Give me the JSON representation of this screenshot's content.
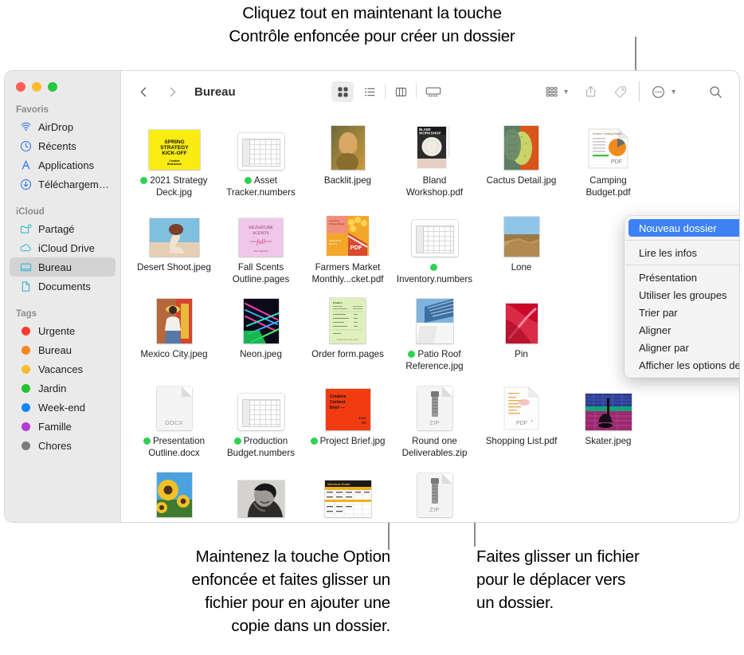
{
  "callouts": {
    "top": "Cliquez tout en maintenant la touche\nContrôle enfoncée pour créer un dossier",
    "option_drag": "Maintenez la touche Option\nenfoncée et faites glisser un\nfichier pour en ajouter une\ncopie dans un dossier.",
    "move_drag": "Faites glisser un fichier\npour le déplacer vers\nun dossier."
  },
  "window": {
    "title": "Bureau"
  },
  "sidebar": {
    "sections": [
      {
        "title": "Favoris",
        "items": [
          {
            "label": "AirDrop",
            "icon": "airdrop-icon",
            "selected": false
          },
          {
            "label": "Récents",
            "icon": "clock-icon",
            "selected": false
          },
          {
            "label": "Applications",
            "icon": "applications-icon",
            "selected": false
          },
          {
            "label": "Téléchargements",
            "icon": "downloads-icon",
            "selected": false
          }
        ]
      },
      {
        "title": "iCloud",
        "items": [
          {
            "label": "Partagé",
            "icon": "shared-folder-icon",
            "selected": false
          },
          {
            "label": "iCloud Drive",
            "icon": "cloud-icon",
            "selected": false
          },
          {
            "label": "Bureau",
            "icon": "desktop-icon",
            "selected": true
          },
          {
            "label": "Documents",
            "icon": "document-icon",
            "selected": false
          }
        ]
      },
      {
        "title": "Tags",
        "items": [
          {
            "label": "Urgente",
            "icon": "tag-dot-icon",
            "color": "#fc3b33"
          },
          {
            "label": "Bureau",
            "icon": "tag-dot-icon",
            "color": "#f8871f"
          },
          {
            "label": "Vacances",
            "icon": "tag-dot-icon",
            "color": "#f9bc2c"
          },
          {
            "label": "Jardin",
            "icon": "tag-dot-icon",
            "color": "#22c32f"
          },
          {
            "label": "Week-end",
            "icon": "tag-dot-icon",
            "color": "#1386fb"
          },
          {
            "label": "Famille",
            "icon": "tag-dot-icon",
            "color": "#b63ad8"
          },
          {
            "label": "Chores",
            "icon": "tag-dot-icon",
            "color": "#7c7c80"
          }
        ]
      }
    ]
  },
  "toolbar": {
    "back": "back-icon",
    "forward": "forward-icon",
    "views": [
      {
        "name": "icon-view",
        "active": true
      },
      {
        "name": "list-view",
        "active": false
      },
      {
        "name": "column-view",
        "active": false
      },
      {
        "name": "gallery-view",
        "active": false
      }
    ],
    "group_by": "group-by-icon",
    "share": "share-icon",
    "tag": "tag-icon",
    "more": "more-actions-icon",
    "search": "search-icon"
  },
  "files": [
    [
      {
        "name": "2021 Strategy Deck.jpg",
        "tag": true,
        "thumb": "spring-strategy"
      },
      {
        "name": "Asset Tracker.numbers",
        "tag": true,
        "thumb": "numbers"
      },
      {
        "name": "Backlit.jpeg",
        "tag": false,
        "thumb": "backlit"
      },
      {
        "name": "Bland Workshop.pdf",
        "tag": false,
        "thumb": "bland-workshop"
      },
      {
        "name": "Cactus Detail.jpg",
        "tag": false,
        "thumb": "cactus"
      },
      {
        "name": "Camping Budget.pdf",
        "tag": false,
        "thumb": "pdf-chart"
      }
    ],
    [
      {
        "name": "Desert Shoot.jpeg",
        "tag": false,
        "thumb": "desert"
      },
      {
        "name": "Fall Scents Outline.pages",
        "tag": false,
        "thumb": "signature-scents"
      },
      {
        "name": "Farmers Market Monthly...cket.pdf",
        "tag": false,
        "thumb": "farmers-market"
      },
      {
        "name": "Inventory.numbers",
        "tag": true,
        "thumb": "numbers"
      },
      {
        "name": "Lone",
        "tag": false,
        "thumb": "lone"
      },
      {
        "name": "",
        "tag": false,
        "thumb": "hidden"
      }
    ],
    [
      {
        "name": "Mexico City.jpeg",
        "tag": false,
        "thumb": "mexico"
      },
      {
        "name": "Neon.jpeg",
        "tag": false,
        "thumb": "neon"
      },
      {
        "name": "Order form.pages",
        "tag": false,
        "thumb": "order-form"
      },
      {
        "name": "Patio Roof Reference.jpg",
        "tag": true,
        "thumb": "patio"
      },
      {
        "name": "Pin",
        "tag": false,
        "thumb": "pink-flower"
      },
      {
        "name": "",
        "tag": false,
        "thumb": "hidden"
      }
    ],
    [
      {
        "name": "Presentation Outline.docx",
        "tag": true,
        "thumb": "docx"
      },
      {
        "name": "Production Budget.numbers",
        "tag": true,
        "thumb": "numbers"
      },
      {
        "name": "Project Brief.jpg",
        "tag": true,
        "thumb": "creative-brief"
      },
      {
        "name": "Round one Deliverables.zip",
        "tag": false,
        "thumb": "zip"
      },
      {
        "name": "Shopping List.pdf",
        "tag": false,
        "thumb": "pdf-list"
      },
      {
        "name": "Skater.jpeg",
        "tag": false,
        "thumb": "skater"
      }
    ],
    [
      {
        "name": "",
        "tag": false,
        "thumb": "sunflower"
      },
      {
        "name": "",
        "tag": false,
        "thumb": "bw-portrait"
      },
      {
        "name": "",
        "tag": false,
        "thumb": "workout-guide"
      },
      {
        "name": "",
        "tag": false,
        "thumb": "zip"
      },
      {
        "name": "",
        "tag": false,
        "thumb": "hidden"
      },
      {
        "name": "",
        "tag": false,
        "thumb": "hidden"
      }
    ]
  ],
  "context_menu": {
    "items": [
      {
        "label": "Nouveau dossier",
        "selected": true,
        "submenu": false,
        "sep_after": true
      },
      {
        "label": "Lire les infos",
        "selected": false,
        "submenu": false,
        "sep_after": true
      },
      {
        "label": "Présentation",
        "selected": false,
        "submenu": true,
        "sep_after": false
      },
      {
        "label": "Utiliser les groupes",
        "selected": false,
        "submenu": false,
        "sep_after": false
      },
      {
        "label": "Trier par",
        "selected": false,
        "submenu": true,
        "sep_after": false
      },
      {
        "label": "Aligner",
        "selected": false,
        "submenu": false,
        "sep_after": false
      },
      {
        "label": "Aligner par",
        "selected": false,
        "submenu": true,
        "sep_after": false
      },
      {
        "label": "Afficher les options de présentation",
        "selected": false,
        "submenu": false,
        "sep_after": false
      }
    ]
  },
  "colors": {
    "accent": "#3d81f5",
    "tag_green": "#2fd152",
    "sidebar_bg": "#ebeaea",
    "leader": "#8a8a8a"
  }
}
